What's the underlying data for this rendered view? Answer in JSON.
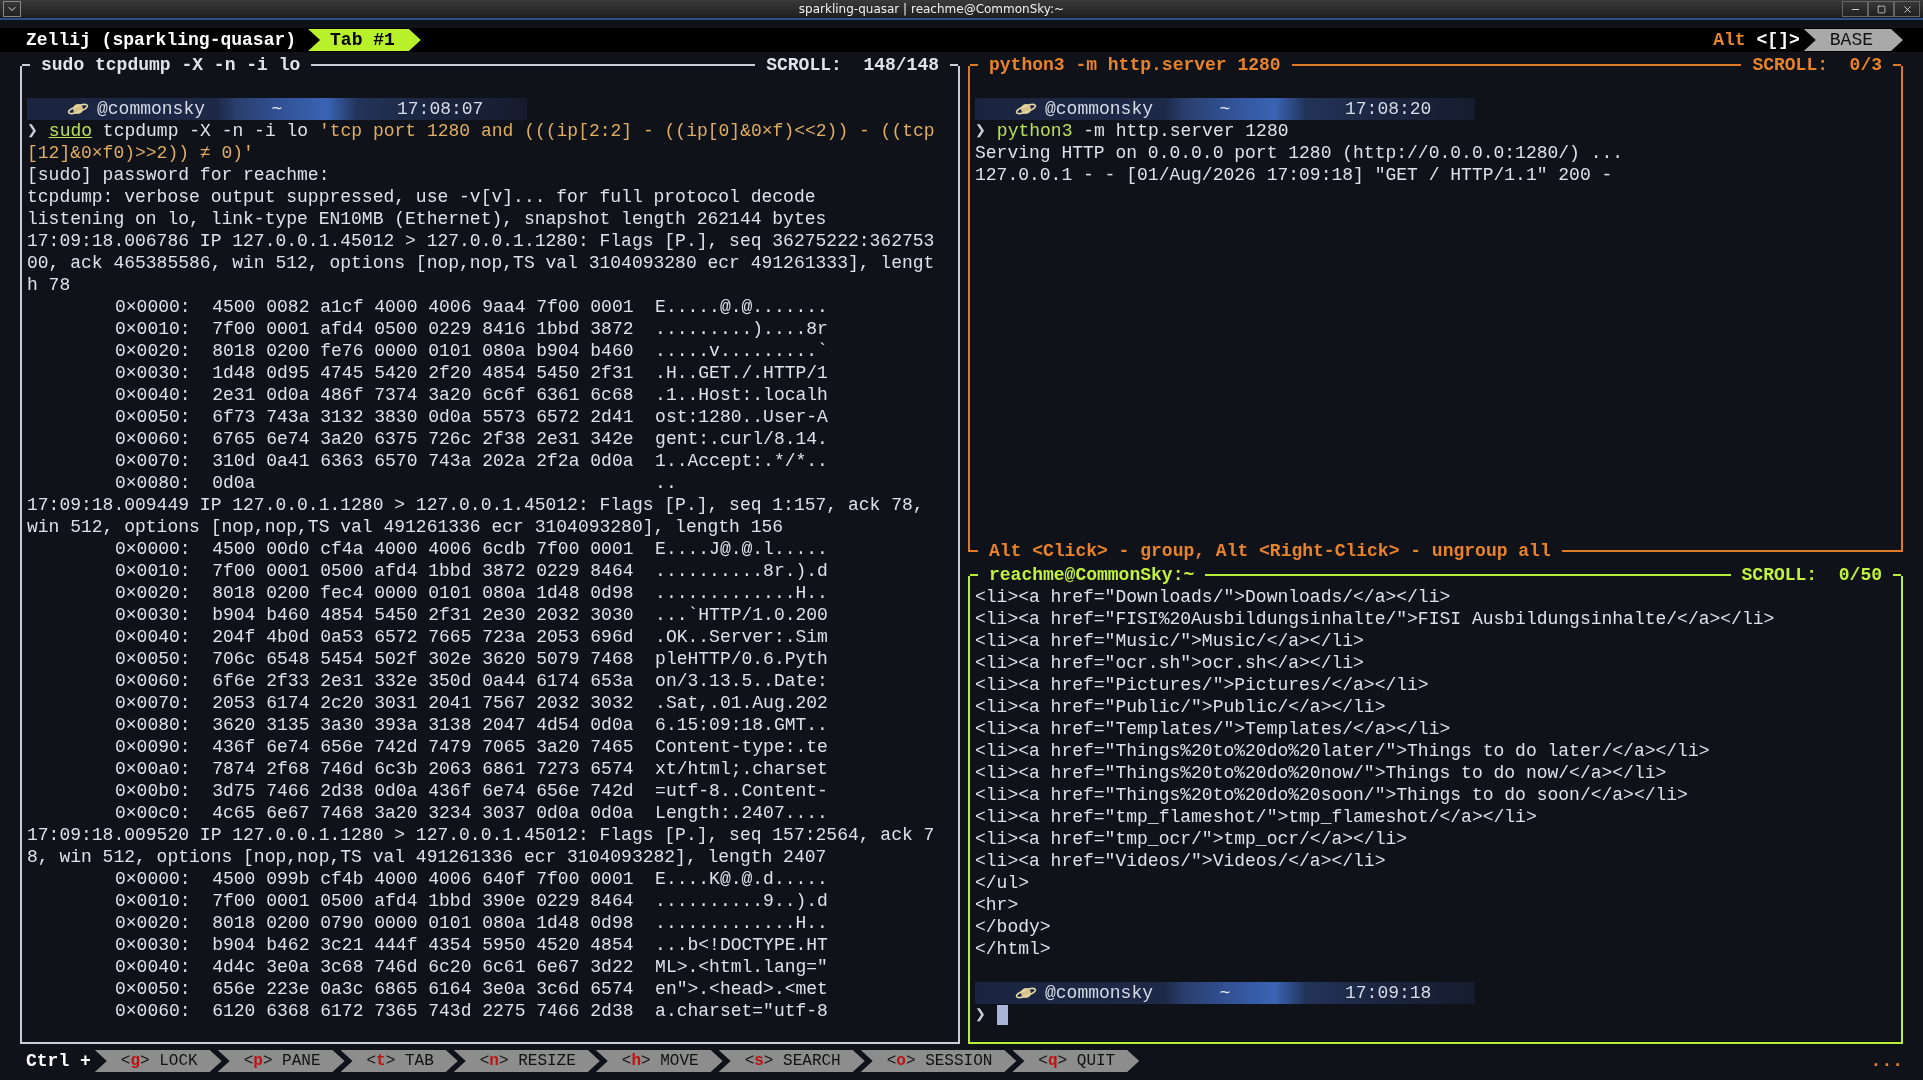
{
  "window": {
    "title": "sparkling-quasar | reachme@CommonSky:~"
  },
  "tab_bar": {
    "session": "Zellij (sparkling-quasar)",
    "tabs": [
      {
        "label": "Tab #1",
        "selected": true
      }
    ],
    "mode_modifier": "Alt",
    "mode_keys": "<[]>",
    "mode": "BASE"
  },
  "left_pane": {
    "title": "sudo tcpdump -X -n -i lo",
    "scroll": "SCROLL:  148/148",
    "focused": false,
    "grouped": false,
    "lines": [
      {
        "kind": "prompt",
        "user": "@commonsky",
        "dir": "~",
        "time": "17:08:07"
      },
      {
        "kind": "command",
        "symbol": "❯",
        "segments": [
          {
            "kind": "program",
            "text": "sudo"
          },
          {
            "kind": "text",
            "text": " tcpdump -X -n -i lo "
          },
          {
            "kind": "string",
            "text": "'tcp port 1280 and (((ip[2:2] - ((ip[0]&0×f)<<2)) - ((tcp"
          }
        ]
      },
      {
        "kind": "wrapped",
        "segments": [
          {
            "kind": "string",
            "text": "[12]&0×f0)>>2)) ≠ 0)'"
          }
        ]
      },
      {
        "kind": "output",
        "text": "[sudo] password for reachme:"
      },
      {
        "kind": "output",
        "text": "tcpdump: verbose output suppressed, use -v[v]... for full protocol decode"
      },
      {
        "kind": "output",
        "text": "listening on lo, link-type EN10MB (Ethernet), snapshot length 262144 bytes"
      },
      {
        "kind": "output",
        "text": "17:09:18.006786 IP 127.0.0.1.45012 > 127.0.0.1.1280: Flags [P.], seq 36275222:362753"
      },
      {
        "kind": "output",
        "text": "00, ack 465385586, win 512, options [nop,nop,TS val 3104093280 ecr 491261333], lengt"
      },
      {
        "kind": "output",
        "text": "h 78"
      },
      {
        "kind": "hex",
        "text": "0×0000:  4500 0082 a1cf 4000 4006 9aa4 7f00 0001  E.....@.@......."
      },
      {
        "kind": "hex",
        "text": "0×0010:  7f00 0001 afd4 0500 0229 8416 1bbd 3872  .........)....8r"
      },
      {
        "kind": "hex",
        "text": "0×0020:  8018 0200 fe76 0000 0101 080a b904 b460  .....v.........`"
      },
      {
        "kind": "hex",
        "text": "0×0030:  1d48 0d95 4745 5420 2f20 4854 5450 2f31  .H..GET./.HTTP/1"
      },
      {
        "kind": "hex",
        "text": "0×0040:  2e31 0d0a 486f 7374 3a20 6c6f 6361 6c68  .1..Host:.localh"
      },
      {
        "kind": "hex",
        "text": "0×0050:  6f73 743a 3132 3830 0d0a 5573 6572 2d41  ost:1280..User-A"
      },
      {
        "kind": "hex",
        "text": "0×0060:  6765 6e74 3a20 6375 726c 2f38 2e31 342e  gent:.curl/8.14."
      },
      {
        "kind": "hex",
        "text": "0×0070:  310d 0a41 6363 6570 743a 202a 2f2a 0d0a  1..Accept:.*/*.."
      },
      {
        "kind": "hex",
        "text": "0×0080:  0d0a                                     .."
      },
      {
        "kind": "output",
        "text": "17:09:18.009449 IP 127.0.0.1.1280 > 127.0.0.1.45012: Flags [P.], seq 1:157, ack 78,"
      },
      {
        "kind": "output",
        "text": "win 512, options [nop,nop,TS val 491261336 ecr 3104093280], length 156"
      },
      {
        "kind": "hex",
        "text": "0×0000:  4500 00d0 cf4a 4000 4006 6cdb 7f00 0001  E....J@.@.l....."
      },
      {
        "kind": "hex",
        "text": "0×0010:  7f00 0001 0500 afd4 1bbd 3872 0229 8464  ..........8r.).d"
      },
      {
        "kind": "hex",
        "text": "0×0020:  8018 0200 fec4 0000 0101 080a 1d48 0d98  .............H.."
      },
      {
        "kind": "hex",
        "text": "0×0030:  b904 b460 4854 5450 2f31 2e30 2032 3030  ...`HTTP/1.0.200"
      },
      {
        "kind": "hex",
        "text": "0×0040:  204f 4b0d 0a53 6572 7665 723a 2053 696d  .OK..Server:.Sim"
      },
      {
        "kind": "hex",
        "text": "0×0050:  706c 6548 5454 502f 302e 3620 5079 7468  pleHTTP/0.6.Pyth"
      },
      {
        "kind": "hex",
        "text": "0×0060:  6f6e 2f33 2e31 332e 350d 0a44 6174 653a  on/3.13.5..Date:"
      },
      {
        "kind": "hex",
        "text": "0×0070:  2053 6174 2c20 3031 2041 7567 2032 3032  .Sat,.01.Aug.202"
      },
      {
        "kind": "hex",
        "text": "0×0080:  3620 3135 3a30 393a 3138 2047 4d54 0d0a  6.15:09:18.GMT.."
      },
      {
        "kind": "hex",
        "text": "0×0090:  436f 6e74 656e 742d 7479 7065 3a20 7465  Content-type:.te"
      },
      {
        "kind": "hex",
        "text": "0×00a0:  7874 2f68 746d 6c3b 2063 6861 7273 6574  xt/html;.charset"
      },
      {
        "kind": "hex",
        "text": "0×00b0:  3d75 7466 2d38 0d0a 436f 6e74 656e 742d  =utf-8..Content-"
      },
      {
        "kind": "hex",
        "text": "0×00c0:  4c65 6e67 7468 3a20 3234 3037 0d0a 0d0a  Length:.2407...."
      },
      {
        "kind": "output",
        "text": "17:09:18.009520 IP 127.0.0.1.1280 > 127.0.0.1.45012: Flags [P.], seq 157:2564, ack 7"
      },
      {
        "kind": "output",
        "text": "8, win 512, options [nop,nop,TS val 491261336 ecr 3104093282], length 2407"
      },
      {
        "kind": "hex",
        "text": "0×0000:  4500 099b cf4b 4000 4006 640f 7f00 0001  E....K@.@.d....."
      },
      {
        "kind": "hex",
        "text": "0×0010:  7f00 0001 0500 afd4 1bbd 390e 0229 8464  ..........9..).d"
      },
      {
        "kind": "hex",
        "text": "0×0020:  8018 0200 0790 0000 0101 080a 1d48 0d98  .............H.."
      },
      {
        "kind": "hex",
        "text": "0×0030:  b904 b462 3c21 444f 4354 5950 4520 4854  ...b<!DOCTYPE.HT"
      },
      {
        "kind": "hex",
        "text": "0×0040:  4d4c 3e0a 3c68 746d 6c20 6c61 6e67 3d22  ML>.<html.lang=\""
      },
      {
        "kind": "hex",
        "text": "0×0050:  656e 223e 0a3c 6865 6164 3e0a 3c6d 6574  en\">.<head>.<met"
      },
      {
        "kind": "hex",
        "text": "0×0060:  6120 6368 6172 7365 743d 2275 7466 2d38  a.charset=\"utf-8"
      }
    ]
  },
  "top_right_pane": {
    "title": "python3 -m http.server 1280",
    "scroll": "SCROLL:  0/3",
    "focused": false,
    "grouped": true,
    "footer": "Alt <Click> - group, Alt <Right-Click> - ungroup all",
    "lines": [
      {
        "kind": "prompt",
        "user": "@commonsky",
        "dir": "~",
        "time": "17:08:20"
      },
      {
        "kind": "command",
        "symbol": "❯",
        "segments": [
          {
            "kind": "program_ok",
            "text": "python3"
          },
          {
            "kind": "text",
            "text": " -m http.server 1280"
          }
        ]
      },
      {
        "kind": "output",
        "text": "Serving HTTP on 0.0.0.0 port 1280 (http://0.0.0.0:1280/) ..."
      },
      {
        "kind": "output",
        "text": "127.0.0.1 - - [01/Aug/2026 17:09:18] \"GET / HTTP/1.1\" 200 -"
      }
    ]
  },
  "bottom_right_pane": {
    "title": "reachme@CommonSky:~",
    "scroll": "SCROLL:  0/50",
    "focused": true,
    "grouped": false,
    "lines": [
      {
        "kind": "output",
        "text": "<li><a href=\"Downloads/\">Downloads/</a></li>"
      },
      {
        "kind": "output",
        "text": "<li><a href=\"FISI%20Ausbildungsinhalte/\">FISI Ausbildungsinhalte/</a></li>"
      },
      {
        "kind": "output",
        "text": "<li><a href=\"Music/\">Music/</a></li>"
      },
      {
        "kind": "output",
        "text": "<li><a href=\"ocr.sh\">ocr.sh</a></li>"
      },
      {
        "kind": "output",
        "text": "<li><a href=\"Pictures/\">Pictures/</a></li>"
      },
      {
        "kind": "output",
        "text": "<li><a href=\"Public/\">Public/</a></li>"
      },
      {
        "kind": "output",
        "text": "<li><a href=\"Templates/\">Templates/</a></li>"
      },
      {
        "kind": "output",
        "text": "<li><a href=\"Things%20to%20do%20later/\">Things to do later/</a></li>"
      },
      {
        "kind": "output",
        "text": "<li><a href=\"Things%20to%20do%20now/\">Things to do now/</a></li>"
      },
      {
        "kind": "output",
        "text": "<li><a href=\"Things%20to%20do%20soon/\">Things to do soon/</a></li>"
      },
      {
        "kind": "output",
        "text": "<li><a href=\"tmp_flameshot/\">tmp_flameshot/</a></li>"
      },
      {
        "kind": "output",
        "text": "<li><a href=\"tmp_ocr/\">tmp_ocr/</a></li>"
      },
      {
        "kind": "output",
        "text": "<li><a href=\"Videos/\">Videos/</a></li>"
      },
      {
        "kind": "output",
        "text": "</ul>"
      },
      {
        "kind": "output",
        "text": "<hr>"
      },
      {
        "kind": "output",
        "text": "</body>"
      },
      {
        "kind": "output",
        "text": "</html>"
      },
      {
        "kind": "blank"
      },
      {
        "kind": "prompt",
        "user": "@commonsky",
        "dir": "~",
        "time": "17:09:18"
      },
      {
        "kind": "input",
        "symbol": "❯"
      }
    ]
  },
  "status_bar": {
    "modifier": "Ctrl +",
    "keybindings": [
      {
        "key": "<g>",
        "label": "LOCK"
      },
      {
        "key": "<p>",
        "label": "PANE"
      },
      {
        "key": "<t>",
        "label": "TAB"
      },
      {
        "key": "<n>",
        "label": "RESIZE"
      },
      {
        "key": "<h>",
        "label": "MOVE"
      },
      {
        "key": "<s>",
        "label": "SEARCH"
      },
      {
        "key": "<o>",
        "label": "SESSION"
      },
      {
        "key": "<q>",
        "label": "QUIT"
      }
    ],
    "overflow": "..."
  }
}
